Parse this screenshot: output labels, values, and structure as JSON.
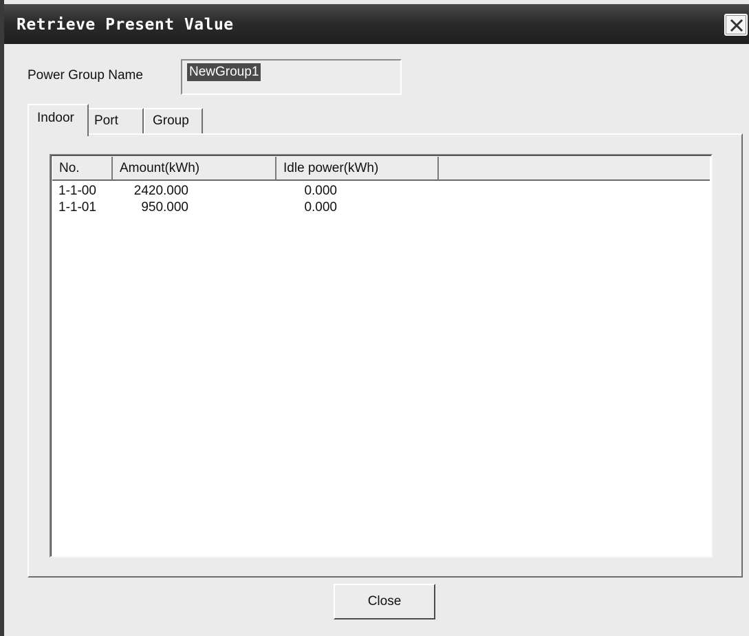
{
  "window": {
    "title": "Retrieve Present Value"
  },
  "form": {
    "power_group_label": "Power Group Name",
    "power_group_value": "NewGroup1"
  },
  "tabs": [
    {
      "label": "Indoor",
      "active": true
    },
    {
      "label": "Port",
      "active": false
    },
    {
      "label": "Group",
      "active": false
    }
  ],
  "table": {
    "columns": [
      "No.",
      "Amount(kWh)",
      "Idle power(kWh)"
    ],
    "rows": [
      {
        "no": "1-1-00",
        "amount": "2420.000",
        "idle": "0.000"
      },
      {
        "no": "1-1-01",
        "amount": "950.000",
        "idle": "0.000"
      }
    ]
  },
  "buttons": {
    "close_label": "Close"
  },
  "icons": {
    "title_close": "close-icon"
  }
}
